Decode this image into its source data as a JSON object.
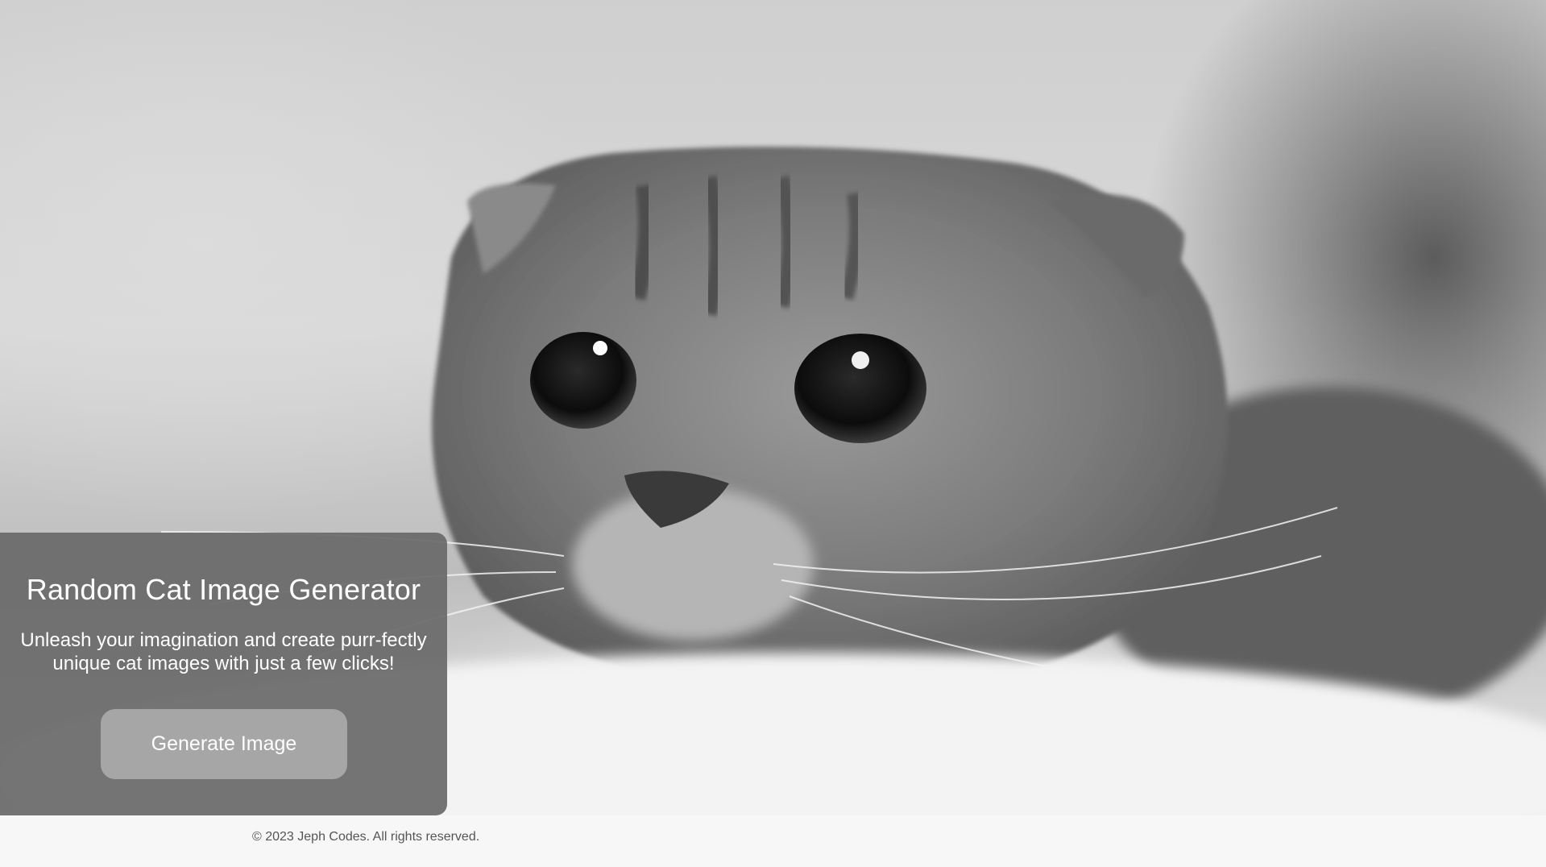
{
  "hero": {
    "image_subject": "grayscale close-up photo of a Scottish Fold kitten with wide eyes"
  },
  "card": {
    "title": "Random Cat Image Generator",
    "subtitle": "Unleash your imagination and create purr-fectly unique cat images with just a few clicks!",
    "button_label": "Generate Image"
  },
  "footer": {
    "copyright": "© 2023 Jeph Codes. All rights reserved."
  },
  "colors": {
    "card_background": "#696969",
    "button_background": "#a6a6a6",
    "footer_background": "#f7f7f8",
    "footer_text": "#555555"
  }
}
